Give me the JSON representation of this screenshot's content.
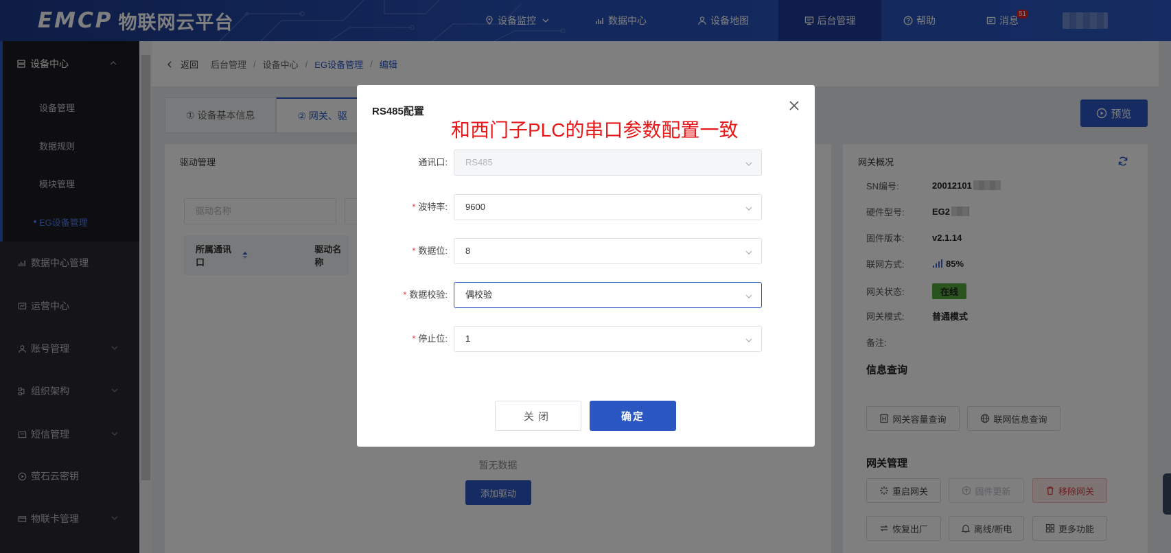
{
  "header": {
    "logo_mark": "EMCP",
    "logo_sub": "物联网云平台",
    "nav": [
      {
        "label": "设备监控",
        "icon": "location-pin-icon"
      },
      {
        "label": "数据中心",
        "icon": "bar-chart-icon"
      },
      {
        "label": "设备地图",
        "icon": "user-icon"
      },
      {
        "label": "后台管理",
        "icon": "monitor-icon"
      },
      {
        "label": "帮助",
        "icon": "help-circle-icon"
      },
      {
        "label": "消息",
        "icon": "message-icon",
        "badge": "51"
      }
    ]
  },
  "sidebar": {
    "group": {
      "label": "设备中心"
    },
    "items": [
      {
        "label": "设备管理"
      },
      {
        "label": "数据规则"
      },
      {
        "label": "模块管理"
      },
      {
        "label": "EG设备管理"
      }
    ],
    "menus": [
      {
        "label": "数据中心管理"
      },
      {
        "label": "运营中心"
      },
      {
        "label": "账号管理"
      },
      {
        "label": "组织架构"
      },
      {
        "label": "短信管理"
      },
      {
        "label": "萤石云密钥"
      },
      {
        "label": "物联卡管理"
      }
    ]
  },
  "breadcrumb": {
    "back": "返回",
    "items": [
      "后台管理",
      "设备中心",
      "EG设备管理",
      "编辑"
    ]
  },
  "tabs": [
    "① 设备基本信息",
    "② 网关、驱"
  ],
  "preview_label": "预览",
  "driver_panel": {
    "title": "驱动管理",
    "search_placeholder": "驱动名称",
    "col_port": "所属通讯口",
    "col_name": "驱动名称",
    "empty": "暂无数据",
    "add_label": "添加驱动"
  },
  "gateway_panel": {
    "title": "网关概况",
    "rows": [
      {
        "label": "SN编号:",
        "value": "20012101"
      },
      {
        "label": "硬件型号:",
        "value": "EG2"
      },
      {
        "label": "固件版本:",
        "value": "v2.1.14"
      },
      {
        "label": "联网方式:",
        "value": "85%"
      },
      {
        "label": "网关状态:",
        "value": "在线"
      },
      {
        "label": "网关模式:",
        "value": "普通模式"
      },
      {
        "label": "备注:",
        "value": ""
      }
    ],
    "info_title": "信息查询",
    "info_buttons": [
      "网关容量查询",
      "联网信息查询"
    ],
    "mgmt_title": "网关管理",
    "mgmt_buttons": [
      "重启网关",
      "固件更新",
      "移除网关",
      "恢复出厂",
      "离线/断电",
      "更多功能"
    ]
  },
  "modal": {
    "title": "RS485配置",
    "annotation": "和西门子PLC的串口参数配置一致",
    "fields": [
      {
        "label": "通讯口:",
        "value": "RS485",
        "required": false
      },
      {
        "label": "波特率:",
        "value": "9600",
        "required": true
      },
      {
        "label": "数据位:",
        "value": "8",
        "required": true
      },
      {
        "label": "数据校验:",
        "value": "偶校验",
        "required": true
      },
      {
        "label": "停止位:",
        "value": "1",
        "required": true
      }
    ],
    "required_mark": "*",
    "close_label": "关闭",
    "ok_label": "确定"
  },
  "colors": {
    "primary": "#2a57c2",
    "annotation": "#e8191b",
    "online": "#52a83a",
    "danger": "#e03e3e"
  }
}
